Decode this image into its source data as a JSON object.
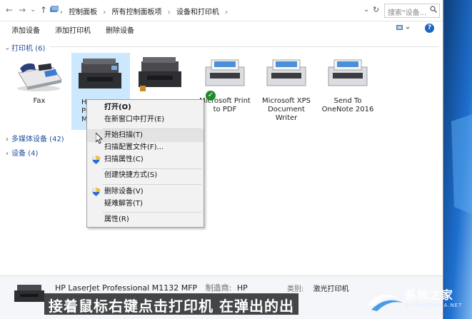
{
  "address": {
    "breadcrumbs": [
      "控制面板",
      "所有控制面板项",
      "设备和打印机"
    ],
    "search_placeholder": "搜索\"设备...",
    "back_glyph": "←",
    "forward_glyph": "→",
    "dropdown_glyph": "⌄",
    "up_glyph": "↑",
    "crumb_sep": "›",
    "refresh_glyph": "↻"
  },
  "toolbar": {
    "add_device": "添加设备",
    "add_printer": "添加打印机",
    "remove_device": "删除设备",
    "help": "?"
  },
  "groups": {
    "printers": "打印机 (6)",
    "multimedia": "多媒体设备 (42)",
    "devices": "设备 (4)"
  },
  "devices": [
    {
      "label": "Fax"
    },
    {
      "label": "HP\nPr\nM"
    },
    {
      "label": ""
    },
    {
      "label": "Microsoft Print\nto PDF"
    },
    {
      "label": "Microsoft XPS\nDocument\nWriter"
    },
    {
      "label": "Send To\nOneNote 2016"
    }
  ],
  "menu": {
    "open": "打开(O)",
    "open_new_window": "在新窗口中打开(E)",
    "start_scan": "开始扫描(T)",
    "scan_profiles": "扫描配置文件(F)...",
    "scan_properties": "扫描属性(C)",
    "create_shortcut": "创建快捷方式(S)",
    "remove_device": "删除设备(V)",
    "troubleshoot": "疑难解答(T)",
    "properties": "属性(R)"
  },
  "details": {
    "name": "HP LaserJet Professional M1132 MFP",
    "maker_label": "制造商:",
    "maker": "HP",
    "category_label": "类别:",
    "category": "激光打印机"
  },
  "subtitle": "接着鼠标右键点击打印机 在弹出的出",
  "watermark": {
    "name": "系统之家",
    "url": "XITONGZHIJIA.NET"
  },
  "colors": {
    "selection": "#cce8ff",
    "link_blue": "#1e4f9a",
    "check_green": "#1f8a2a",
    "desktop_blue": "#1b4f8a"
  }
}
